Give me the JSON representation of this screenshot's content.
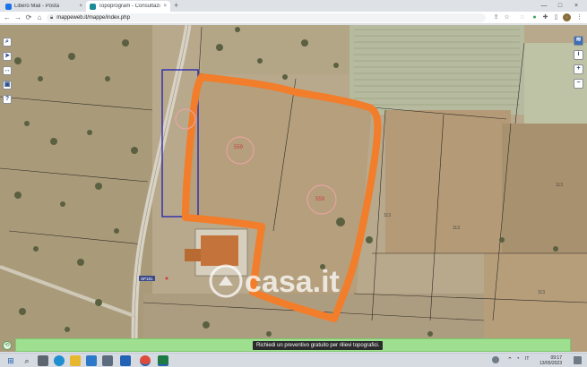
{
  "browser": {
    "tabs": [
      {
        "title": "Libero Mail - Posta",
        "close": "×",
        "favicon_color": "#1a73e8"
      },
      {
        "title": "Topoprogram - Consultazione c…",
        "close": "×",
        "favicon_color": "#1d8a99"
      }
    ],
    "new_tab": "+",
    "window_controls": {
      "minimize": "—",
      "maximize": "□",
      "close": "×"
    },
    "address": "mappeweb.it/mappe/index.php",
    "nav": {
      "back": "←",
      "forward": "→",
      "reload": "⟳",
      "home": "⌂"
    }
  },
  "map": {
    "parcel_labels": [
      "559",
      "559",
      "113",
      "113",
      "113",
      "113"
    ],
    "road_label": "SP181",
    "left_tools": [
      "search-icon",
      "pointer-icon",
      "measure-icon",
      "layers-icon",
      "help-icon"
    ],
    "right_tools": [
      "map-layers-icon",
      "info-icon",
      "zoom-in-icon",
      "zoom-out-icon"
    ],
    "right_tool_glyphs": [
      "≋",
      "i",
      "+",
      "−"
    ],
    "left_tool_glyphs": [
      "⌕",
      "➤",
      "↔",
      "▣",
      "?"
    ],
    "watermark": "casa.it",
    "banner_cta": "Richiedi un preventivo gratuito per rilievi topografici.",
    "bottom_left_glyph": "⟲"
  },
  "taskbar": {
    "start_glyph": "⊞",
    "search_glyph": "⌕",
    "apps": [
      "task-view",
      "edge",
      "file-explorer",
      "mail",
      "chrome",
      "excel",
      "store",
      "outlook"
    ],
    "tray_lang": "IT",
    "time": "09:17",
    "date": "13/05/2023"
  },
  "colors": {
    "parcel_outline": "#f27d2a",
    "selection_box": "#2020b0",
    "parcel_label": "#c84040",
    "banner": "#9ee08f"
  }
}
